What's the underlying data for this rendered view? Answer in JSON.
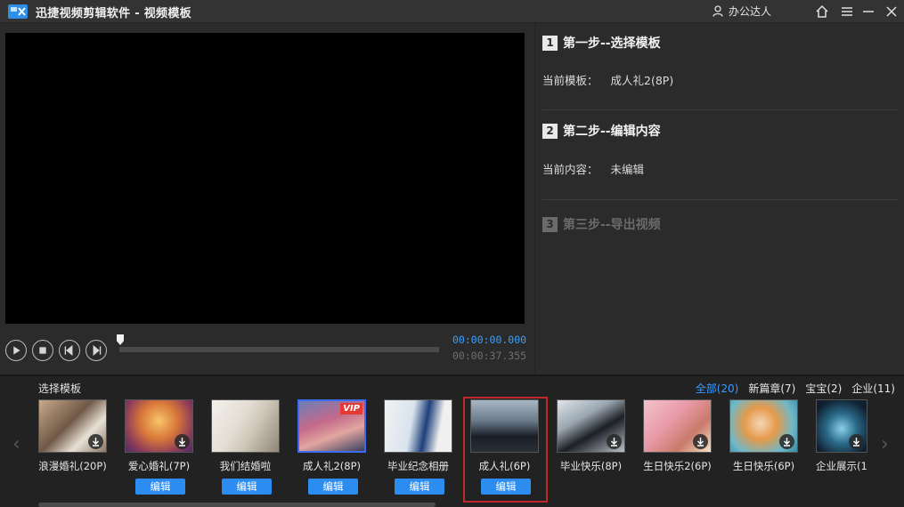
{
  "window": {
    "title": "迅捷视频剪辑软件 - 视频模板",
    "user_name": "办公达人"
  },
  "player": {
    "current_time": "00:00:00.000",
    "total_time": "00:00:37.355",
    "progress": 0
  },
  "steps": [
    {
      "num": "1",
      "title": "第一步--选择模板",
      "info_label": "当前模板：",
      "info_value": "成人礼2(8P)"
    },
    {
      "num": "2",
      "title": "第二步--编辑内容",
      "info_label": "当前内容：",
      "info_value": "未编辑"
    },
    {
      "num": "3",
      "title": "第三步--导出视频"
    }
  ],
  "templates_panel": {
    "label": "选择模板",
    "categories": [
      "全部(20)",
      "新篇章(7)",
      "宝宝(2)",
      "企业(11)"
    ],
    "active_category": "全部(20)",
    "edit_label": "编辑",
    "vip_label": "VIP",
    "items": [
      {
        "name": "浪漫婚礼(20P)",
        "has_edit": false,
        "download": true
      },
      {
        "name": "爱心婚礼(7P)",
        "has_edit": true,
        "download": true
      },
      {
        "name": "我们结婚啦",
        "has_edit": true,
        "download": false
      },
      {
        "name": "成人礼2(8P)",
        "has_edit": true,
        "download": false,
        "vip": true
      },
      {
        "name": "毕业纪念相册",
        "has_edit": true,
        "download": false
      },
      {
        "name": "成人礼(6P)",
        "has_edit": true,
        "download": false,
        "selected": true
      },
      {
        "name": "毕业快乐(8P)",
        "has_edit": false,
        "download": true
      },
      {
        "name": "生日快乐2(6P)",
        "has_edit": false,
        "download": true
      },
      {
        "name": "生日快乐(6P)",
        "has_edit": false,
        "download": true
      },
      {
        "name": "企业展示(1",
        "has_edit": false,
        "download": true
      }
    ]
  },
  "colors": {
    "accent": "#2d8cf0",
    "selection": "#c0282d",
    "time": "#3aa0ff"
  }
}
